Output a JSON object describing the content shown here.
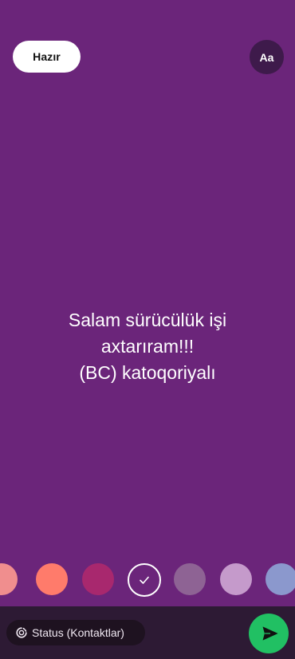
{
  "header": {
    "done_label": "Hazır",
    "font_label": "Aa"
  },
  "status": {
    "lines": [
      "Salam sürücülük işi",
      "axtarıram!!!",
      "(BC) katoqoriyalı"
    ],
    "background_color": "#6B257A"
  },
  "colors": {
    "swatches": [
      "#F08E8E",
      "#FF7B6B",
      "#A8286E",
      "#6B257A",
      "#8E6394",
      "#C59ACB",
      "#8B98CD"
    ],
    "selected_index": 3
  },
  "footer": {
    "audience_label": "Status (Kontaktlar)",
    "send_icon": "send-icon"
  }
}
